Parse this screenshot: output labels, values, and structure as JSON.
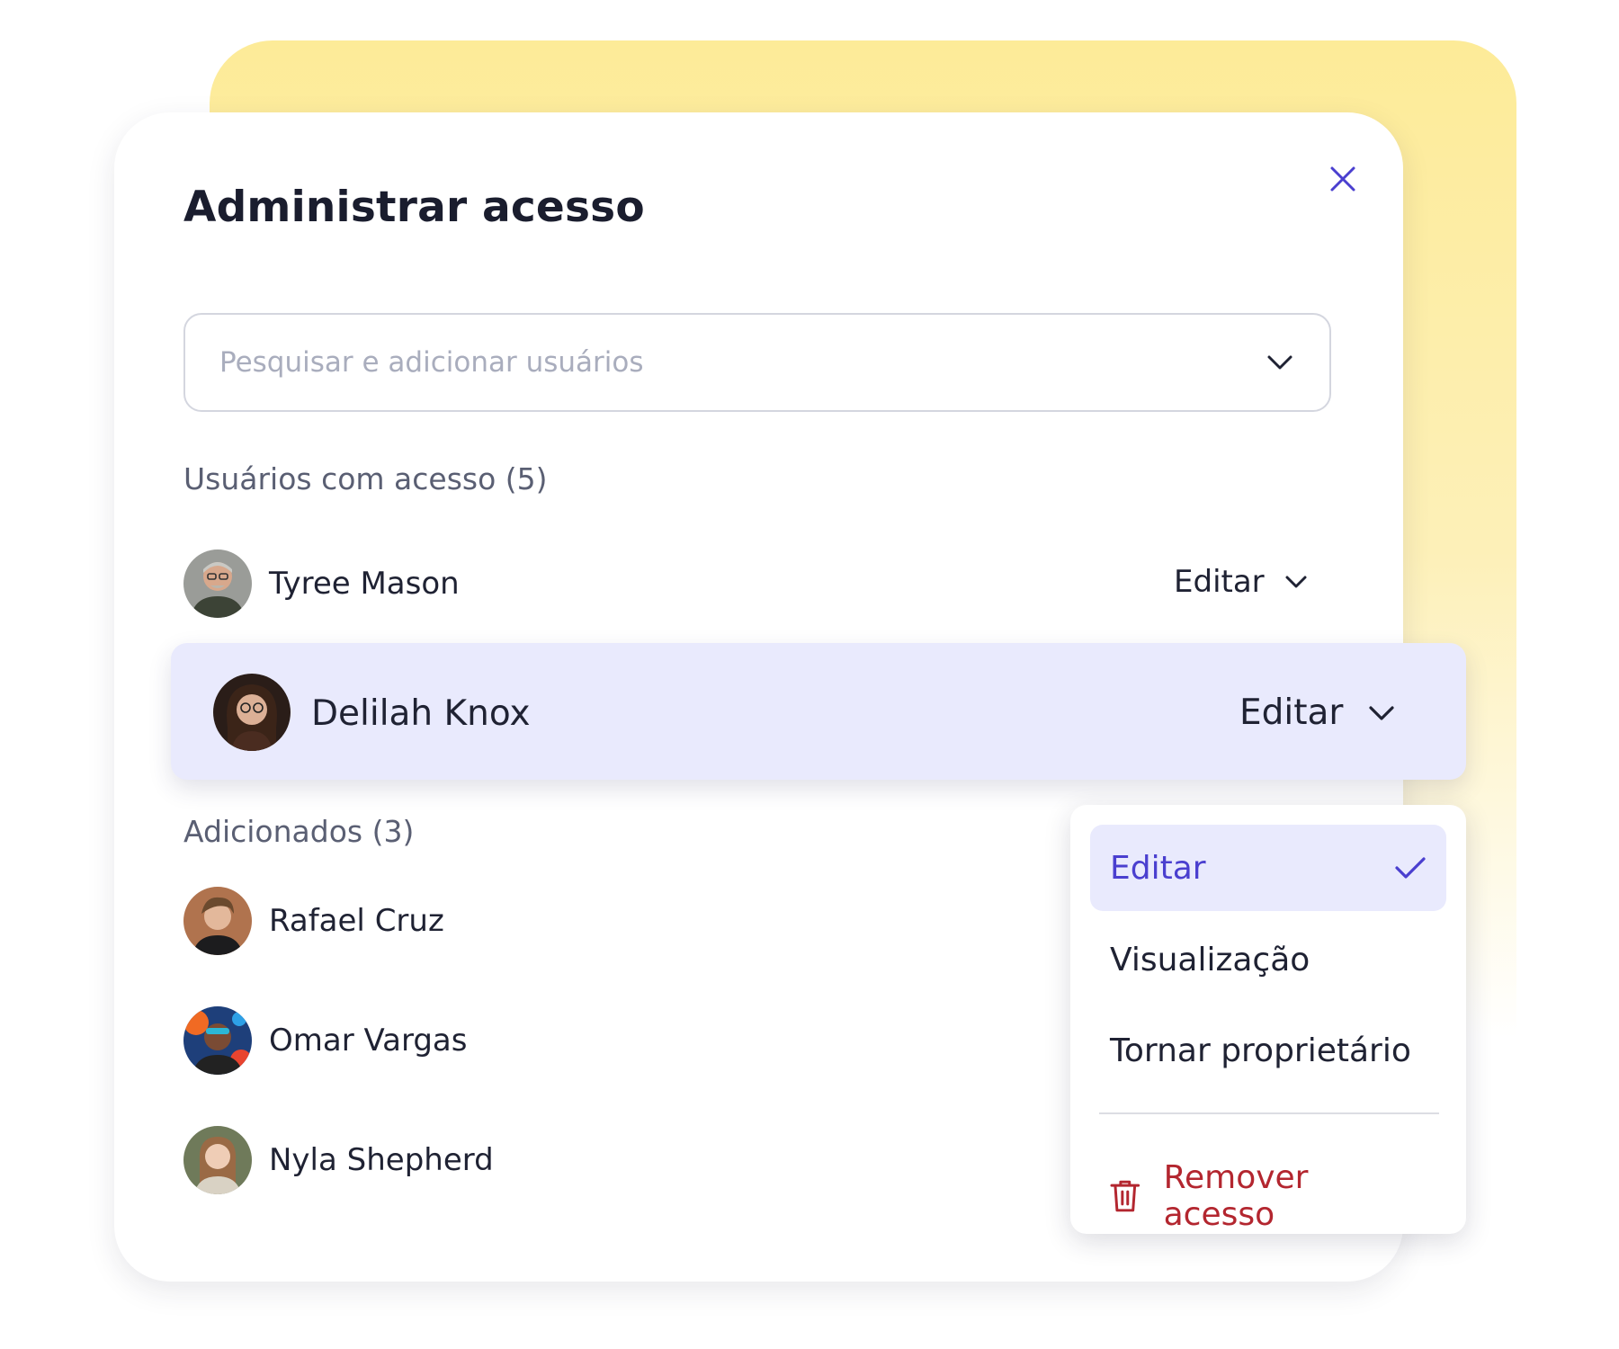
{
  "dialog": {
    "title": "Administrar acesso",
    "close_icon": "close-icon"
  },
  "search": {
    "placeholder": "Pesquisar e adicionar usuários",
    "value": "",
    "icon": "chevron-down-icon"
  },
  "sections": {
    "with_access": "Usuários com acesso (5)",
    "added": "Adicionados (3)"
  },
  "users_with_access": [
    {
      "name": "Tyree Mason",
      "role": "Editar"
    },
    {
      "name": "Delilah Knox",
      "role": "Editar",
      "active": true
    }
  ],
  "added_users": [
    {
      "name": "Rafael Cruz"
    },
    {
      "name": "Omar Vargas"
    },
    {
      "name": "Nyla Shepherd"
    }
  ],
  "role_menu": {
    "items": [
      {
        "label": "Editar",
        "selected": true,
        "icon": "check-icon"
      },
      {
        "label": "Visualização",
        "selected": false
      },
      {
        "label": "Tornar proprietário",
        "selected": false
      }
    ],
    "remove": {
      "label": "Remover acesso",
      "icon": "trash-icon"
    }
  },
  "colors": {
    "accent": "#4a3fcf",
    "highlight": "#e9eafd",
    "danger": "#b3262f",
    "backdrop": "#fdeb98"
  }
}
